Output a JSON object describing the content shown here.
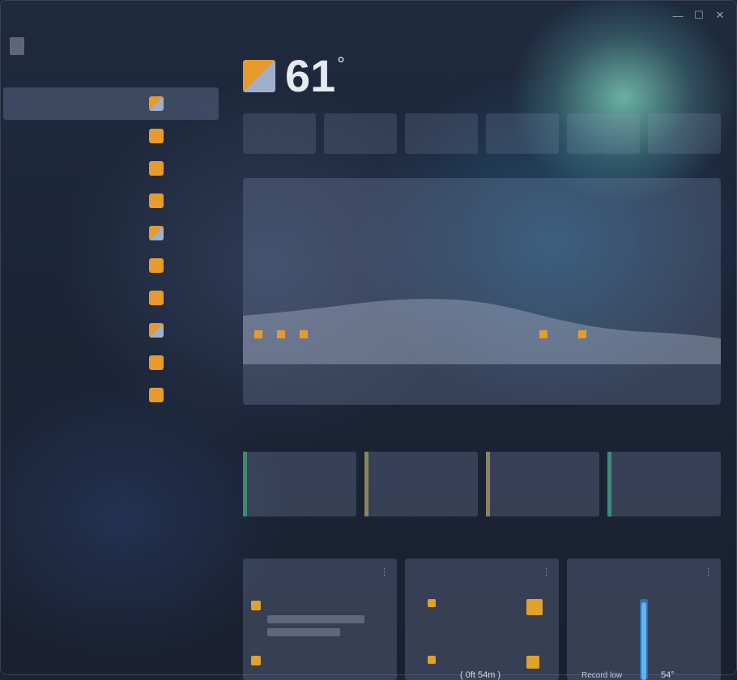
{
  "window": {
    "minimize": "—",
    "maximize": "☐",
    "close": "✕"
  },
  "sidebar": {
    "title": "",
    "subtitle": "",
    "locations": [
      {
        "name": "",
        "icon": "partly-cloudy",
        "temps": ""
      },
      {
        "name": "",
        "icon": "sunny",
        "temps": ""
      },
      {
        "name": "",
        "icon": "sunny",
        "temps": ""
      },
      {
        "name": "",
        "icon": "sunny",
        "temps": ""
      },
      {
        "name": "",
        "icon": "partly-cloudy",
        "temps": ""
      },
      {
        "name": "",
        "icon": "sunny",
        "temps": ""
      },
      {
        "name": "",
        "icon": "sunny",
        "temps": ""
      },
      {
        "name": "",
        "icon": "partly-cloudy",
        "temps": ""
      },
      {
        "name": "",
        "icon": "sunny",
        "temps": ""
      },
      {
        "name": "",
        "icon": "sunny",
        "temps": ""
      }
    ],
    "footer": ""
  },
  "current": {
    "temp": "61",
    "unit": "°",
    "icon": "partly-cloudy",
    "condition": "",
    "details": ""
  },
  "metrics": [
    {
      "label": "",
      "value": ""
    },
    {
      "label": "",
      "value": ""
    },
    {
      "label": "",
      "value": ""
    },
    {
      "label": "",
      "value": ""
    },
    {
      "label": "",
      "value": ""
    },
    {
      "label": "",
      "value": ""
    }
  ],
  "forecast": {
    "tabs": [
      "",
      "",
      ""
    ],
    "hours": [
      "",
      "",
      "",
      "",
      "",
      "",
      "",
      "",
      "",
      "",
      "",
      ""
    ],
    "precip": [
      "",
      "",
      "",
      "",
      "",
      "",
      "",
      "",
      "",
      "",
      "",
      ""
    ]
  },
  "sections": {
    "days_title": "",
    "details_title": ""
  },
  "day_cards": [
    {
      "accent": "#3f8a6e",
      "title": "",
      "line1": "",
      "line2": ""
    },
    {
      "accent": "#8a845a",
      "title": "",
      "line1": "",
      "line2": ""
    },
    {
      "accent": "#8a845a",
      "title": "",
      "line1": "",
      "line2": ""
    },
    {
      "accent": "#3f8a7e",
      "title": "",
      "line1": "",
      "line2": ""
    }
  ],
  "detail_cards": {
    "sun": {
      "title": ""
    },
    "wind": {
      "title": "",
      "altitude_label": "( 0ft 54m )"
    },
    "temperature": {
      "title": "",
      "record_low_label": "Record low",
      "record_low_value": "54°"
    }
  },
  "colors": {
    "sun": "#e89a2a",
    "accent_blue": "#4a8fd6",
    "thermo": "#5fb6ee"
  }
}
